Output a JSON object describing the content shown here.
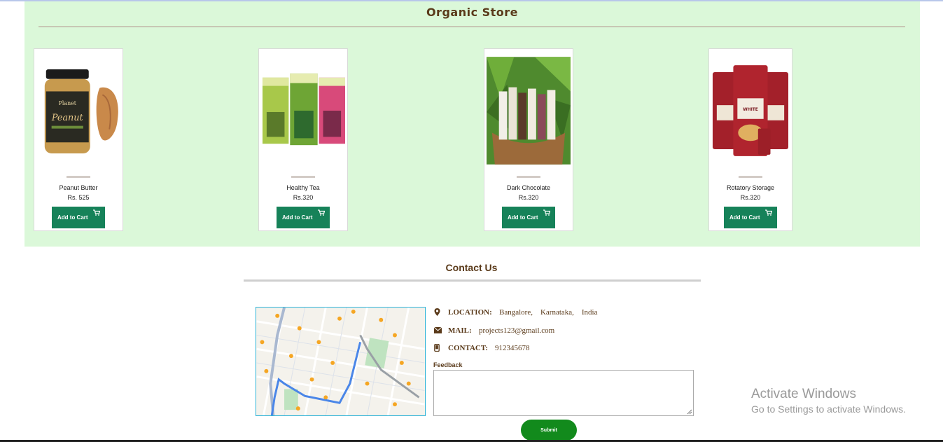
{
  "store": {
    "title": "Organic Store",
    "add_to_cart_label": "Add to Cart",
    "products": [
      {
        "name": "Peanut Butter",
        "price": "Rs. 525"
      },
      {
        "name": "Healthy Tea",
        "price": "Rs.320"
      },
      {
        "name": "Dark Chocolate",
        "price": "Rs.320"
      },
      {
        "name": "Rotatory Storage",
        "price": "Rs.320"
      }
    ]
  },
  "contact": {
    "title": "Contact Us",
    "location_label": "LOCATION:",
    "location_value": "Bangalore,    Karnataka,    India",
    "mail_label": "MAIL:",
    "mail_value": "projects123@gmail.com",
    "contact_label": "CONTACT:",
    "contact_value": "912345678",
    "feedback_label": "Feedback",
    "submit_label": "Submit"
  },
  "watermark": {
    "line1": "Activate Windows",
    "line2": "Go to Settings to activate Windows."
  },
  "colors": {
    "store_bg": "#dbf8d9",
    "cart_button": "#168259",
    "submit_button": "#128a1c",
    "heading_brown": "#5a3a1a"
  }
}
